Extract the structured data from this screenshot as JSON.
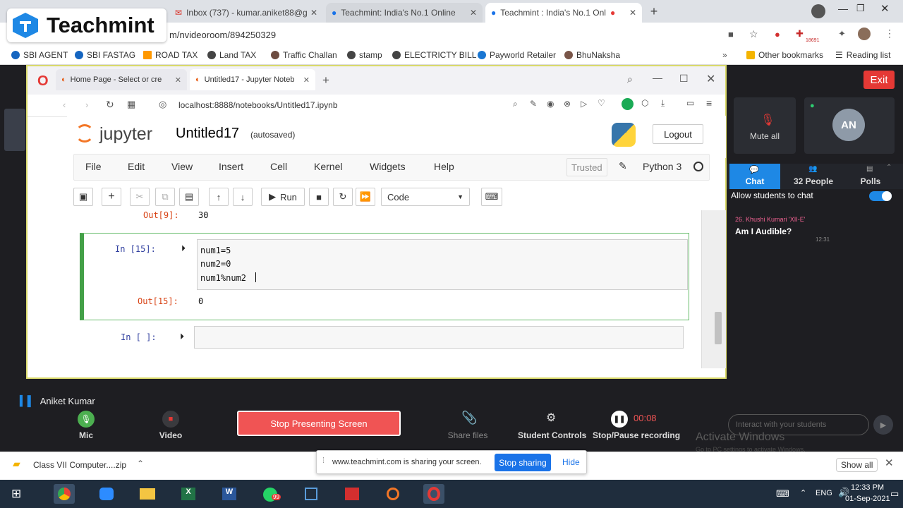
{
  "chrome": {
    "tabs": [
      {
        "label": "Inbox (737) - kumar.aniket88@g"
      },
      {
        "label": "Teachmint: India's No.1 Online"
      },
      {
        "label": "Teachmint : India's No.1 Onl"
      }
    ],
    "url": "m/nvideoroom/894250329",
    "bookmarks": [
      "SBI AGENT",
      "SBI FASTAG",
      "ROAD TAX",
      "Land TAX",
      "Traffic Challan",
      "stamp",
      "ELECTRICTY BILL",
      "Payworld Retailer",
      "BhuNaksha"
    ],
    "other_bookmarks": "Other bookmarks",
    "reading_list": "Reading list",
    "ext_badge": "18691"
  },
  "teachmint": {
    "logo_text": "Teachmint",
    "exit": "Exit",
    "presenter": "Aniket Kumar",
    "controls": {
      "mic": "Mic",
      "video": "Video",
      "stop_presenting": "Stop Presenting Screen",
      "share_files": "Share files",
      "student_controls": "Student Controls",
      "stop_pause_recording": "Stop/Pause recording",
      "timer": "00:08"
    },
    "right_panel": {
      "mute_all": "Mute all",
      "avatar_initials": "AN",
      "tabs": [
        {
          "label": "Chat"
        },
        {
          "label": "32 People"
        },
        {
          "label": "Polls"
        }
      ],
      "allow_chat": "Allow students to chat",
      "message": {
        "sender": "26. Khushi Kumari 'XII-E'",
        "text": "Am I Audible?",
        "time": "12:31"
      },
      "chat_placeholder": "Interact with your students"
    },
    "share_bar": {
      "text": "www.teachmint.com is sharing your screen.",
      "stop": "Stop sharing",
      "hide": "Hide"
    },
    "watermark": {
      "title": "Activate Windows",
      "subtitle": "Go to PC settings to activate Windows."
    }
  },
  "inner_browser": {
    "tabs": [
      {
        "label": "Home Page - Select or cre"
      },
      {
        "label": "Untitled17 - Jupyter Noteb"
      }
    ],
    "url": "localhost:8888/notebooks/Untitled17.ipynb"
  },
  "jupyter": {
    "logo_text": "jupyter",
    "notebook_name": "Untitled17",
    "autosaved": "(autosaved)",
    "logout": "Logout",
    "menu": [
      "File",
      "Edit",
      "View",
      "Insert",
      "Cell",
      "Kernel",
      "Widgets",
      "Help"
    ],
    "trusted": "Trusted",
    "kernel_name": "Python 3",
    "toolbar": {
      "run": "Run",
      "cell_type": "Code"
    },
    "cells": {
      "prev_out_prompt": "Out[9]:",
      "prev_out_value": "30",
      "active_in_prompt": "In [15]:",
      "active_code": [
        "num1=5",
        "num2=0",
        "num1%num2"
      ],
      "active_out_prompt": "Out[15]:",
      "active_out_value": "0",
      "empty_in_prompt": "In [ ]:"
    }
  },
  "shelf": {
    "download_file": "Class VII Computer....zip",
    "show_all": "Show all"
  },
  "taskbar": {
    "time": "12:33 PM",
    "date": "01-Sep-2021",
    "lang": "ENG",
    "whatsapp_badge": "99"
  }
}
